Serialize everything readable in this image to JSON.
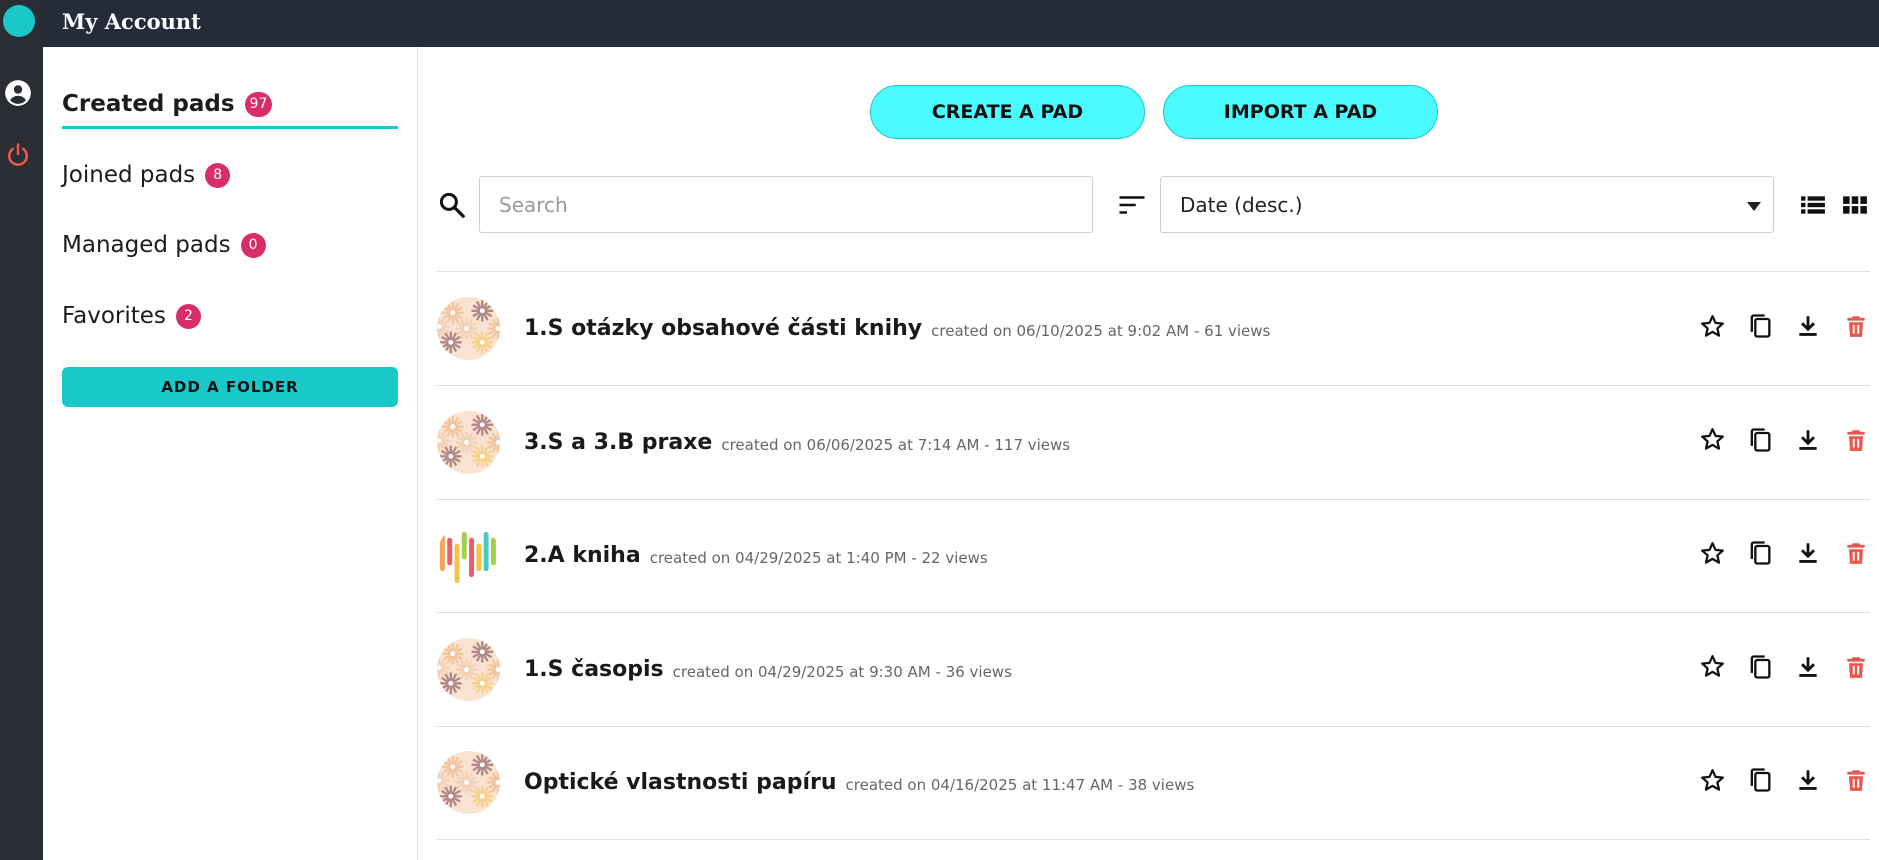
{
  "app": {
    "title": "My Account",
    "accent": "#19c9c9",
    "badge_color": "#d92d65",
    "danger": "#e8574e"
  },
  "rail": {
    "icons": [
      "logo-icon",
      "account-icon",
      "power-icon"
    ]
  },
  "sidebar": {
    "items": [
      {
        "label": "Created pads",
        "count": "97",
        "active": true
      },
      {
        "label": "Joined pads",
        "count": "8"
      },
      {
        "label": "Managed pads",
        "count": "0"
      },
      {
        "label": "Favorites",
        "count": "2"
      }
    ],
    "add_folder_label": "ADD A FOLDER"
  },
  "toolbar": {
    "create_label": "CREATE A PAD",
    "import_label": "IMPORT A PAD",
    "search_placeholder": "Search",
    "search_value": "",
    "sort_value": "Date (desc.)"
  },
  "pads": [
    {
      "title": "1.S otázky obsahové části knihy",
      "meta": "created on 06/10/2025 at 9:02 AM - 61 views",
      "avatar": "flowers"
    },
    {
      "title": "3.S a 3.B praxe",
      "meta": "created on 06/06/2025 at 7:14 AM - 117 views",
      "avatar": "flowers"
    },
    {
      "title": "2.A kniha",
      "meta": "created on 04/29/2025 at 1:40 PM - 22 views",
      "avatar": "stripes"
    },
    {
      "title": "1.S časopis",
      "meta": "created on 04/29/2025 at 9:30 AM - 36 views",
      "avatar": "flowers"
    },
    {
      "title": "Optické vlastnosti papíru",
      "meta": "created on 04/16/2025 at 11:47 AM - 38 views",
      "avatar": "flowers"
    }
  ]
}
